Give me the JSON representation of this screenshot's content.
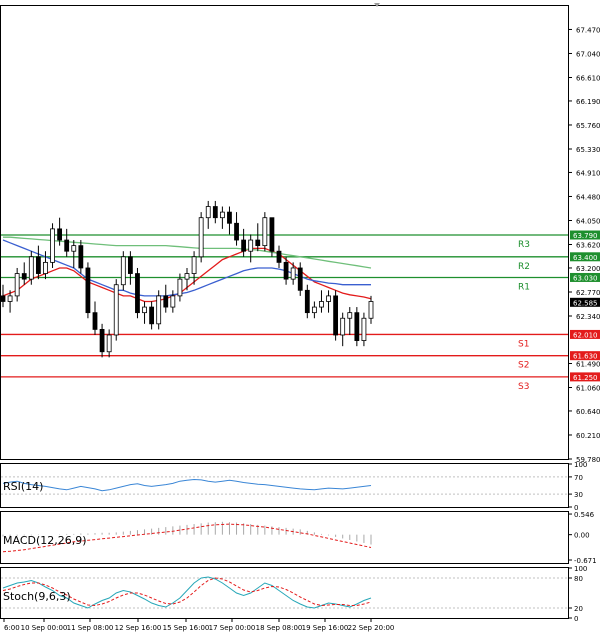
{
  "chart_data": {
    "type": "candlestick",
    "instrument_panels": [
      "main",
      "rsi",
      "macd",
      "stoch"
    ],
    "price_axis": {
      "ticks": [
        "67.470",
        "67.040",
        "66.610",
        "66.190",
        "65.760",
        "65.330",
        "64.910",
        "64.480",
        "64.050",
        "63.620",
        "63.200",
        "62.770",
        "62.340",
        "61.490",
        "61.060",
        "60.640",
        "60.210",
        "59.780"
      ],
      "ylim": [
        59.78,
        67.89
      ]
    },
    "current_price": {
      "label": "62.585",
      "value": 62.585
    },
    "levels": [
      {
        "name": "R3",
        "label": "63.790",
        "value": 63.79,
        "color": "#1e8f2e"
      },
      {
        "name": "R2",
        "label": "63.400",
        "value": 63.4,
        "color": "#1e8f2e"
      },
      {
        "name": "R1",
        "label": "63.030",
        "value": 63.03,
        "color": "#1e8f2e"
      },
      {
        "name": "S1",
        "label": "62.010",
        "value": 62.01,
        "color": "#e31b1b"
      },
      {
        "name": "S2",
        "label": "61.630",
        "value": 61.63,
        "color": "#e31b1b"
      },
      {
        "name": "S3",
        "label": "61.250",
        "value": 61.25,
        "color": "#e31b1b"
      }
    ],
    "x_axis_labels": [
      "6:00",
      "10 Sep 00:00",
      "11 Sep 08:00",
      "12 Sep 16:00",
      "15 Sep 16:00",
      "17 Sep 00:00",
      "18 Sep 08:00",
      "19 Sep 16:00",
      "22 Sep 20:00"
    ],
    "candles": [
      [
        62.7,
        62.9,
        62.5,
        62.6
      ],
      [
        62.6,
        62.8,
        62.4,
        62.7
      ],
      [
        62.7,
        63.2,
        62.6,
        63.1
      ],
      [
        63.1,
        63.3,
        62.9,
        63.0
      ],
      [
        63.0,
        63.5,
        62.9,
        63.4
      ],
      [
        63.4,
        63.6,
        63.0,
        63.1
      ],
      [
        63.1,
        63.5,
        63.0,
        63.3
      ],
      [
        63.3,
        64.0,
        63.2,
        63.9
      ],
      [
        63.9,
        64.1,
        63.6,
        63.7
      ],
      [
        63.7,
        63.9,
        63.4,
        63.5
      ],
      [
        63.5,
        63.7,
        63.2,
        63.6
      ],
      [
        63.6,
        63.7,
        63.1,
        63.2
      ],
      [
        63.2,
        63.3,
        62.3,
        62.4
      ],
      [
        62.4,
        62.6,
        62.0,
        62.1
      ],
      [
        62.1,
        62.2,
        61.6,
        61.7
      ],
      [
        61.7,
        62.1,
        61.6,
        62.0
      ],
      [
        62.0,
        63.0,
        61.9,
        62.9
      ],
      [
        62.9,
        63.5,
        62.8,
        63.4
      ],
      [
        63.4,
        63.5,
        62.9,
        63.1
      ],
      [
        63.1,
        63.2,
        62.3,
        62.4
      ],
      [
        62.4,
        62.6,
        62.2,
        62.5
      ],
      [
        62.5,
        62.6,
        62.1,
        62.2
      ],
      [
        62.2,
        62.8,
        62.1,
        62.7
      ],
      [
        62.7,
        62.9,
        62.4,
        62.5
      ],
      [
        62.5,
        62.8,
        62.4,
        62.7
      ],
      [
        62.7,
        63.1,
        62.6,
        63.0
      ],
      [
        63.0,
        63.2,
        62.8,
        63.1
      ],
      [
        63.1,
        63.5,
        62.9,
        63.4
      ],
      [
        63.4,
        64.2,
        63.3,
        64.1
      ],
      [
        64.1,
        64.4,
        63.9,
        64.3
      ],
      [
        64.3,
        64.4,
        64.0,
        64.1
      ],
      [
        64.1,
        64.3,
        63.9,
        64.2
      ],
      [
        64.2,
        64.3,
        63.8,
        64.0
      ],
      [
        64.0,
        64.2,
        63.6,
        63.7
      ],
      [
        63.7,
        63.9,
        63.4,
        63.5
      ],
      [
        63.5,
        63.8,
        63.3,
        63.7
      ],
      [
        63.7,
        64.0,
        63.5,
        63.6
      ],
      [
        63.6,
        64.2,
        63.5,
        64.1
      ],
      [
        64.1,
        64.1,
        63.4,
        63.5
      ],
      [
        63.5,
        63.6,
        63.2,
        63.3
      ],
      [
        63.3,
        63.4,
        62.9,
        63.0
      ],
      [
        63.0,
        63.3,
        62.9,
        63.2
      ],
      [
        63.2,
        63.3,
        62.7,
        62.8
      ],
      [
        62.8,
        62.9,
        62.3,
        62.4
      ],
      [
        62.4,
        62.6,
        62.3,
        62.5
      ],
      [
        62.5,
        62.8,
        62.4,
        62.6
      ],
      [
        62.6,
        62.8,
        62.4,
        62.7
      ],
      [
        62.7,
        62.8,
        61.9,
        62.0
      ],
      [
        62.0,
        62.4,
        61.8,
        62.3
      ],
      [
        62.3,
        62.5,
        62.0,
        62.4
      ],
      [
        62.4,
        62.5,
        61.8,
        61.9
      ],
      [
        61.9,
        62.4,
        61.8,
        62.3
      ],
      [
        62.3,
        62.7,
        62.2,
        62.6
      ]
    ],
    "moving_averages": [
      {
        "color": "#e31b1b",
        "values": [
          62.7,
          62.75,
          62.8,
          62.9,
          63.0,
          63.05,
          63.1,
          63.15,
          63.2,
          63.2,
          63.15,
          63.05,
          62.95,
          62.9,
          62.85,
          62.8,
          62.75,
          62.7,
          62.7,
          62.65,
          62.6,
          62.6,
          62.62,
          62.65,
          62.7,
          62.75,
          62.85,
          62.95,
          63.05,
          63.15,
          63.25,
          63.35,
          63.4,
          63.45,
          63.5,
          63.55,
          63.55,
          63.55,
          63.5,
          63.45,
          63.35,
          63.25,
          63.15,
          63.05,
          62.95,
          62.9,
          62.85,
          62.8,
          62.75,
          62.72,
          62.7,
          62.68,
          62.65
        ]
      },
      {
        "color": "#3a5fd0",
        "values": [
          63.7,
          63.65,
          63.6,
          63.55,
          63.5,
          63.45,
          63.4,
          63.35,
          63.3,
          63.25,
          63.2,
          63.1,
          63.0,
          62.95,
          62.9,
          62.85,
          62.8,
          62.8,
          62.75,
          62.72,
          62.7,
          62.7,
          62.7,
          62.7,
          62.72,
          62.74,
          62.76,
          62.8,
          62.85,
          62.9,
          62.95,
          63.0,
          63.05,
          63.1,
          63.15,
          63.18,
          63.2,
          63.2,
          63.2,
          63.18,
          63.15,
          63.1,
          63.05,
          63.0,
          62.97,
          62.95,
          62.93,
          62.92,
          62.9,
          62.9,
          62.9,
          62.9,
          62.9
        ]
      },
      {
        "color": "#6fbf7a",
        "values": [
          63.75,
          63.75,
          63.74,
          63.73,
          63.72,
          63.71,
          63.7,
          63.69,
          63.68,
          63.67,
          63.66,
          63.65,
          63.64,
          63.63,
          63.62,
          63.61,
          63.6,
          63.6,
          63.6,
          63.6,
          63.6,
          63.6,
          63.6,
          63.6,
          63.59,
          63.58,
          63.57,
          63.56,
          63.55,
          63.55,
          63.55,
          63.55,
          63.55,
          63.55,
          63.54,
          63.53,
          63.52,
          63.5,
          63.48,
          63.46,
          63.44,
          63.42,
          63.4,
          63.38,
          63.36,
          63.34,
          63.32,
          63.3,
          63.28,
          63.26,
          63.24,
          63.22,
          63.2
        ]
      }
    ],
    "rsi": {
      "label": "RSI(14)",
      "ticks": [
        "100",
        "70",
        "30",
        "0"
      ],
      "values": [
        55,
        58,
        60,
        55,
        52,
        50,
        48,
        45,
        42,
        40,
        44,
        48,
        45,
        42,
        38,
        40,
        44,
        48,
        52,
        54,
        50,
        48,
        50,
        52,
        55,
        60,
        62,
        64,
        63,
        60,
        58,
        60,
        62,
        60,
        57,
        55,
        53,
        52,
        50,
        48,
        46,
        44,
        42,
        41,
        40,
        42,
        44,
        43,
        42,
        44,
        46,
        48,
        50
      ]
    },
    "macd": {
      "label": "MACD(12,26,9)",
      "ticks": [
        "0.546",
        "0.00",
        "-0.671"
      ],
      "ylim": [
        -0.75,
        0.6
      ],
      "signal": [
        -0.45,
        -0.44,
        -0.42,
        -0.4,
        -0.37,
        -0.34,
        -0.31,
        -0.28,
        -0.25,
        -0.22,
        -0.19,
        -0.17,
        -0.15,
        -0.13,
        -0.11,
        -0.09,
        -0.07,
        -0.05,
        -0.03,
        -0.01,
        0.01,
        0.03,
        0.05,
        0.07,
        0.09,
        0.12,
        0.15,
        0.18,
        0.21,
        0.24,
        0.26,
        0.27,
        0.28,
        0.27,
        0.26,
        0.24,
        0.22,
        0.2,
        0.17,
        0.14,
        0.11,
        0.08,
        0.05,
        0.02,
        -0.02,
        -0.06,
        -0.1,
        -0.14,
        -0.18,
        -0.22,
        -0.26,
        -0.3,
        -0.34
      ],
      "histogram": [
        -0.05,
        -0.04,
        -0.03,
        -0.02,
        -0.02,
        -0.01,
        0.0,
        0.0,
        0.01,
        0.02,
        0.02,
        0.03,
        0.03,
        0.04,
        0.05,
        0.05,
        0.06,
        0.08,
        0.1,
        0.12,
        0.14,
        0.16,
        0.18,
        0.2,
        0.22,
        0.24,
        0.26,
        0.28,
        0.3,
        0.32,
        0.33,
        0.34,
        0.33,
        0.32,
        0.3,
        0.28,
        0.26,
        0.24,
        0.22,
        0.2,
        0.18,
        0.16,
        0.14,
        0.1,
        0.06,
        0.02,
        -0.02,
        -0.06,
        -0.1,
        -0.14,
        -0.18,
        -0.22,
        -0.26
      ]
    },
    "stoch": {
      "label": "Stoch(9,6,3)",
      "ticks": [
        "100",
        "80",
        "20",
        "0"
      ],
      "k": [
        60,
        65,
        70,
        72,
        75,
        70,
        62,
        55,
        45,
        40,
        30,
        25,
        20,
        28,
        35,
        40,
        50,
        55,
        52,
        45,
        38,
        30,
        25,
        22,
        30,
        40,
        55,
        70,
        80,
        82,
        78,
        70,
        60,
        50,
        45,
        50,
        60,
        70,
        65,
        55,
        45,
        35,
        28,
        22,
        20,
        25,
        30,
        28,
        25,
        22,
        28,
        35,
        40
      ],
      "d": [
        55,
        58,
        63,
        67,
        70,
        70,
        66,
        60,
        52,
        46,
        38,
        32,
        26,
        25,
        28,
        33,
        40,
        46,
        50,
        50,
        46,
        40,
        34,
        29,
        28,
        32,
        40,
        52,
        65,
        75,
        80,
        78,
        72,
        64,
        56,
        52,
        55,
        60,
        63,
        62,
        57,
        50,
        42,
        35,
        28,
        25,
        26,
        27,
        27,
        25,
        25,
        28,
        32
      ]
    }
  }
}
